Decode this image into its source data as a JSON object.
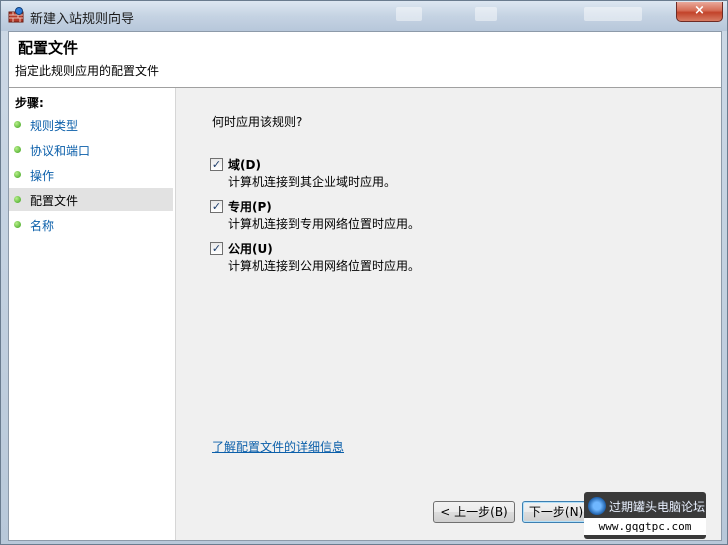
{
  "window": {
    "title": "新建入站规则向导",
    "close_label": "×"
  },
  "header": {
    "title": "配置文件",
    "subtitle": "指定此规则应用的配置文件"
  },
  "steps": {
    "title": "步骤:",
    "items": [
      {
        "label": "规则类型"
      },
      {
        "label": "协议和端口"
      },
      {
        "label": "操作"
      },
      {
        "label": "配置文件",
        "active": true
      },
      {
        "label": "名称"
      }
    ]
  },
  "main": {
    "question": "何时应用该规则?",
    "options": [
      {
        "label": "域(D)",
        "description": "计算机连接到其企业域时应用。",
        "checked": true
      },
      {
        "label": "专用(P)",
        "description": "计算机连接到专用网络位置时应用。",
        "checked": true
      },
      {
        "label": "公用(U)",
        "description": "计算机连接到公用网络位置时应用。",
        "checked": true
      }
    ],
    "learn_link": "了解配置文件的详细信息"
  },
  "buttons": {
    "back": "< 上一步(B)",
    "next": "下一步(N) >"
  },
  "watermark": {
    "text": "过期罐头电脑论坛",
    "url": "www.gqgtpc.com"
  },
  "colors": {
    "link": "#0b5faa",
    "close": "#c2432a",
    "step_dot": "#3aa01c"
  }
}
